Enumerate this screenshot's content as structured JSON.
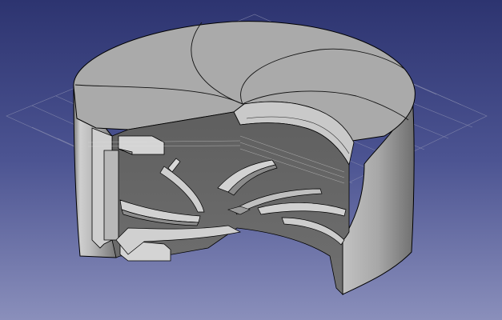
{
  "viewport": {
    "background_top": "#2d3470",
    "background_mid": "#4c5492",
    "background_bottom": "#8a8fbb"
  },
  "model": {
    "body_color": "#a3a3a3",
    "top_face_color": "#a9a9a9",
    "shadow_color": "#5e5e5e",
    "cut_face_color": "#c8c8c8",
    "edge_color": "#000000",
    "grid_color": "#8b8fb0"
  }
}
